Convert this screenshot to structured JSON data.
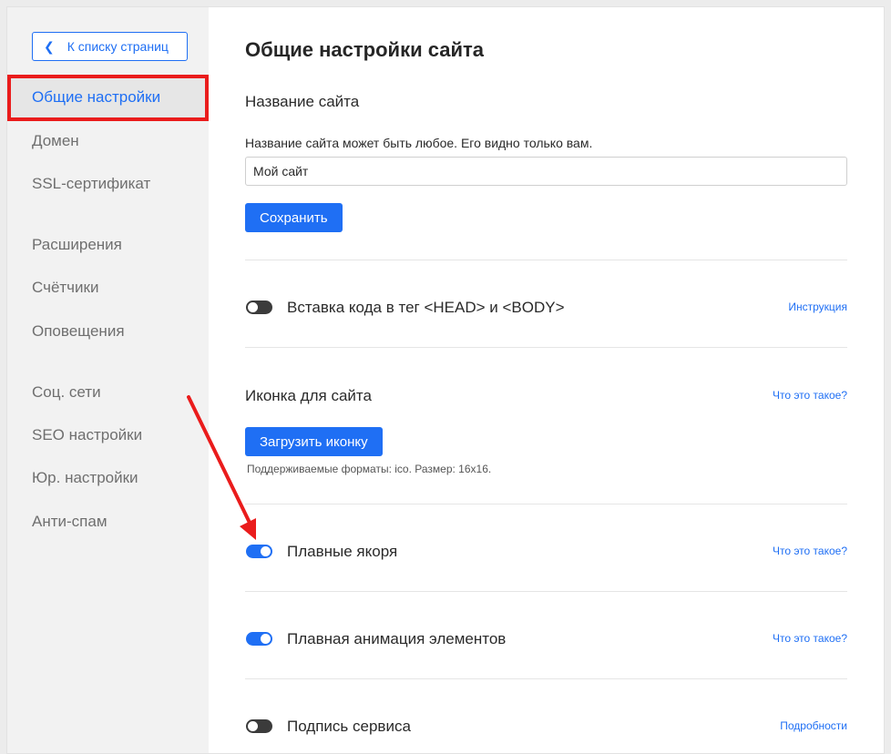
{
  "sidebar": {
    "back_label": "К списку страниц",
    "items": [
      {
        "label": "Общие настройки",
        "active": true
      },
      {
        "label": "Домен"
      },
      {
        "label": "SSL-сертификат"
      },
      {
        "label": "Расширения"
      },
      {
        "label": "Счётчики"
      },
      {
        "label": "Оповещения"
      },
      {
        "label": "Соц. сети"
      },
      {
        "label": "SEO настройки"
      },
      {
        "label": "Юр. настройки"
      },
      {
        "label": "Анти-спам"
      }
    ]
  },
  "main": {
    "title": "Общие настройки сайта",
    "site_name": {
      "label": "Название сайта",
      "hint": "Название сайта может быть любое. Его видно только вам.",
      "value": "Мой сайт",
      "save_label": "Сохранить"
    },
    "code_insert": {
      "label": "Вставка кода в тег <HEAD> и <BODY>",
      "link": "Инструкция",
      "enabled": false
    },
    "favicon": {
      "label": "Иконка для сайта",
      "link": "Что это такое?",
      "upload_label": "Загрузить иконку",
      "note": "Поддерживаемые форматы: ico. Размер: 16x16."
    },
    "smooth_anchors": {
      "label": "Плавные якоря",
      "link": "Что это такое?",
      "enabled": true
    },
    "smooth_animation": {
      "label": "Плавная анимация элементов",
      "link": "Что это такое?",
      "enabled": true
    },
    "service_signature": {
      "label": "Подпись сервиса",
      "link": "Подробности",
      "enabled": false
    }
  },
  "colors": {
    "accent": "#1f6ff4",
    "highlight_red": "#ea1c1c"
  }
}
